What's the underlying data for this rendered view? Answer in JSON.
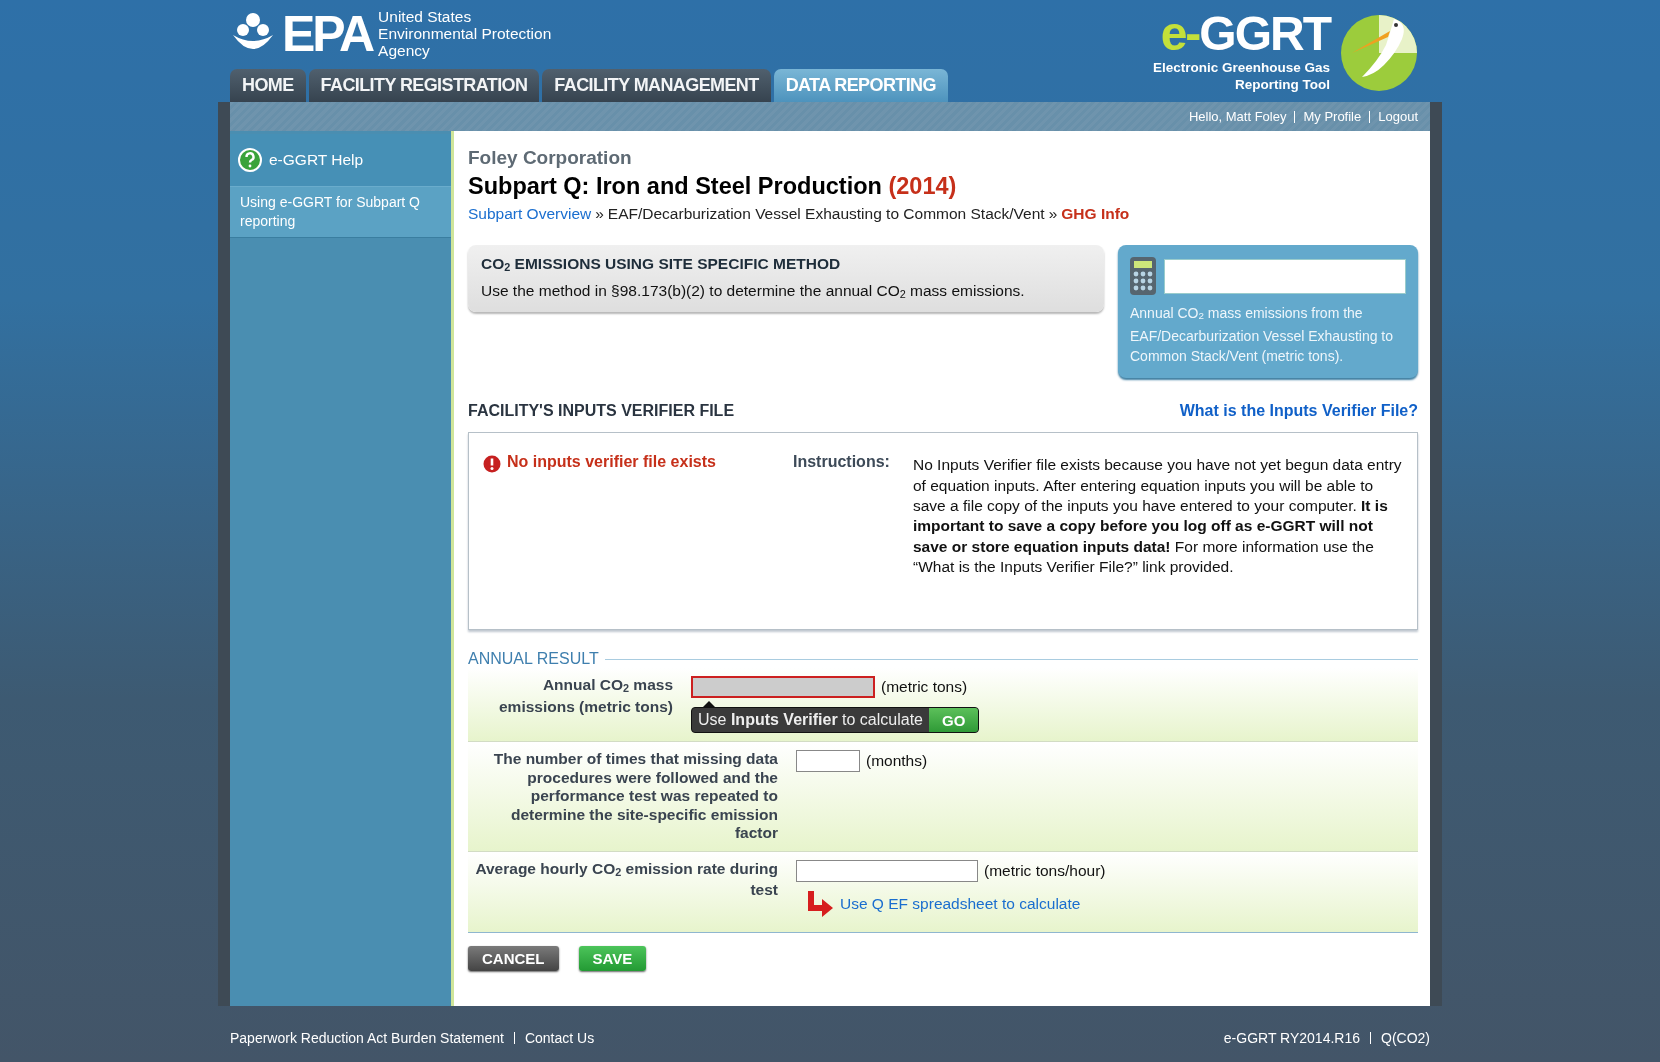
{
  "header": {
    "agency": {
      "mark": "EPA",
      "lines": [
        "United States",
        "Environmental Protection",
        "Agency"
      ]
    },
    "tool": {
      "prefix": "e-",
      "name": "GGRT",
      "lines": [
        "Electronic Greenhouse Gas",
        "Reporting Tool"
      ]
    }
  },
  "tabs": [
    {
      "label": "HOME",
      "selected": false
    },
    {
      "label": "FACILITY REGISTRATION",
      "selected": false
    },
    {
      "label": "FACILITY MANAGEMENT",
      "selected": false
    },
    {
      "label": "DATA REPORTING",
      "selected": true
    }
  ],
  "user_bar": {
    "greeting": "Hello, Matt Foley",
    "links": [
      "My Profile",
      "Logout"
    ]
  },
  "sidebar": {
    "help_title": "e-GGRT Help",
    "items": [
      {
        "label": "Using e-GGRT for Subpart Q reporting",
        "selected": true
      }
    ]
  },
  "content": {
    "company": "Foley Corporation",
    "title": "Subpart Q: Iron and Steel Production",
    "year": "(2014)",
    "breadcrumb": [
      {
        "kind": "link",
        "label": "Subpart Overview"
      },
      {
        "kind": "separator",
        "label": "»"
      },
      {
        "kind": "text",
        "label": "EAF/Decarburization Vessel Exhausting to Common Stack/Vent"
      },
      {
        "kind": "separator",
        "label": "»"
      },
      {
        "kind": "current",
        "label": "GHG Info"
      }
    ],
    "method": {
      "heading": "CO$_{2}$ EMISSIONS USING SITE SPECIFIC METHOD",
      "text": "Use the method in §98.173(b)(2) to determine the annual CO$_{2}$ mass emissions."
    },
    "result_box": {
      "caption": "Annual CO$_{2}$ mass emissions from the EAF/Decarburization Vessel Exhausting to Common Stack/Vent (metric tons)."
    },
    "verifier": {
      "heading": "FACILITY'S INPUTS VERIFIER FILE",
      "help_link": "What is the Inputs Verifier File?",
      "status": "No inputs verifier file exists",
      "instructions_label": "Instructions:",
      "instructions": "No Inputs Verifier file exists because you have not yet begun data entry of equation inputs.  After entering equation inputs you will be able to save a file copy of the inputs you have entered to your computer.  **It is important to save a copy before you log off as e-GGRT will not save or store equation inputs data!** For more information use the “What is the Inputs Verifier File?” link provided."
    },
    "annual_result": {
      "legend": "ANNUAL RESULT",
      "rows": [
        {
          "kind": "computed",
          "label": "Annual CO$_{2}$ mass emissions (metric tons)",
          "unit": "(metric tons)",
          "hint": "Use **Inputs Verifier** to calculate",
          "go": "GO"
        },
        {
          "kind": "input",
          "label": "The number of times that missing data procedures were followed and the performance test was repeated to determine the site-specific emission factor",
          "unit": "(months)"
        },
        {
          "kind": "input-link",
          "label": "Average hourly CO$_{2}$ emission rate during test",
          "unit": "(metric tons/hour)",
          "link": "Use Q EF spreadsheet to calculate"
        }
      ]
    },
    "buttons": [
      {
        "kind": "cancel",
        "label": "CANCEL"
      },
      {
        "kind": "save",
        "label": "SAVE"
      }
    ]
  },
  "footer": {
    "left": [
      "Paperwork Reduction Act Burden Statement",
      "Contact Us"
    ],
    "right": [
      "e-GGRT RY2014.R16",
      "Q(CO2)"
    ]
  }
}
